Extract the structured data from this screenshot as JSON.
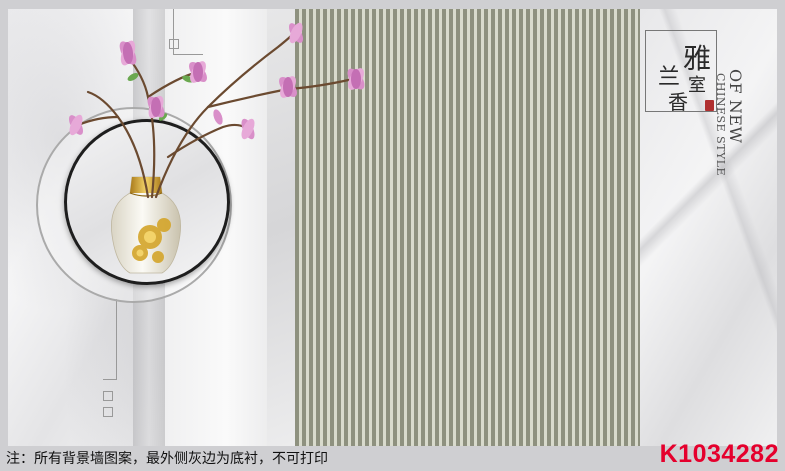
{
  "artwork": {
    "seal": {
      "chars": [
        "雅",
        "室",
        "兰",
        "香"
      ]
    },
    "side_text": {
      "line1": "OF NEW",
      "line2": "CHINESE STYLE"
    }
  },
  "footer": {
    "note": "注：所有背景墙图案，最外侧灰边为底衬，不可打印",
    "code": "K1034282"
  },
  "colors": {
    "stripe_dark": "#8e917f",
    "stripe_light": "#d9dbcd",
    "code_red": "#e5002d",
    "seal_red": "#b03030"
  }
}
